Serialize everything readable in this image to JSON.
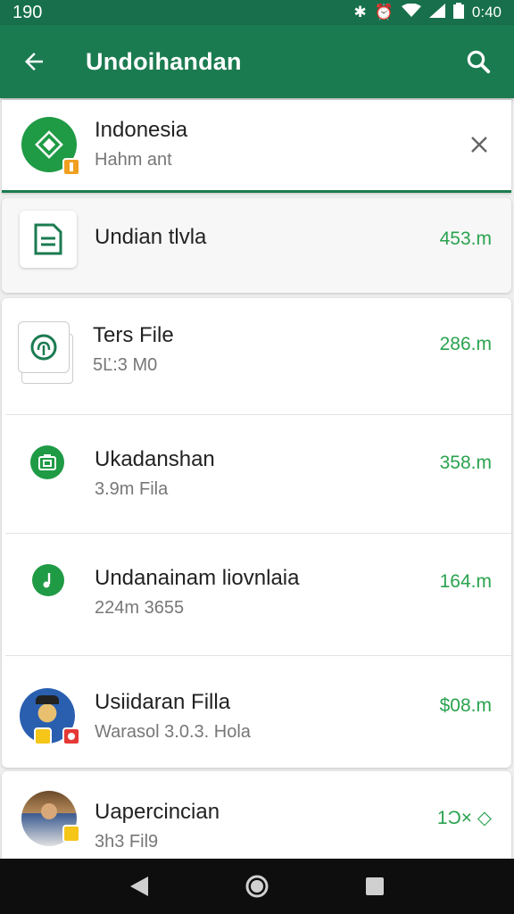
{
  "status_bar": {
    "time_left": "190",
    "time_right": "0:40"
  },
  "app_bar": {
    "title": "Undoihandan"
  },
  "header_item": {
    "title": "Indonesia",
    "subtitle": "Hahm ant"
  },
  "items": [
    {
      "title": "Undian tlvla",
      "subtitle": "",
      "size": "453.m"
    },
    {
      "title": "Ters File",
      "subtitle": "5Ľ:3 M0",
      "size": "286.m"
    },
    {
      "title": "Ukadanshan",
      "subtitle": "3.9m Fila",
      "size": "358.m"
    },
    {
      "title": "Undanainam liovnlaia",
      "subtitle": "224m 3655",
      "size": "164.m"
    },
    {
      "title": "Usiidaran Filla",
      "subtitle": "Warasol 3.0.3. Hola",
      "size": "$08.m"
    },
    {
      "title": "Uapercincian",
      "subtitle": "3h3 Fil9",
      "size": "1Ɔ× ◇"
    }
  ],
  "colors": {
    "primary": "#1b7b50",
    "accent": "#2aa34f",
    "icon_green": "#1f9a45"
  },
  "icons": [
    "back-arrow-icon",
    "search-icon",
    "close-icon",
    "document-icon",
    "cloud-icon",
    "camera-icon",
    "music-icon"
  ]
}
